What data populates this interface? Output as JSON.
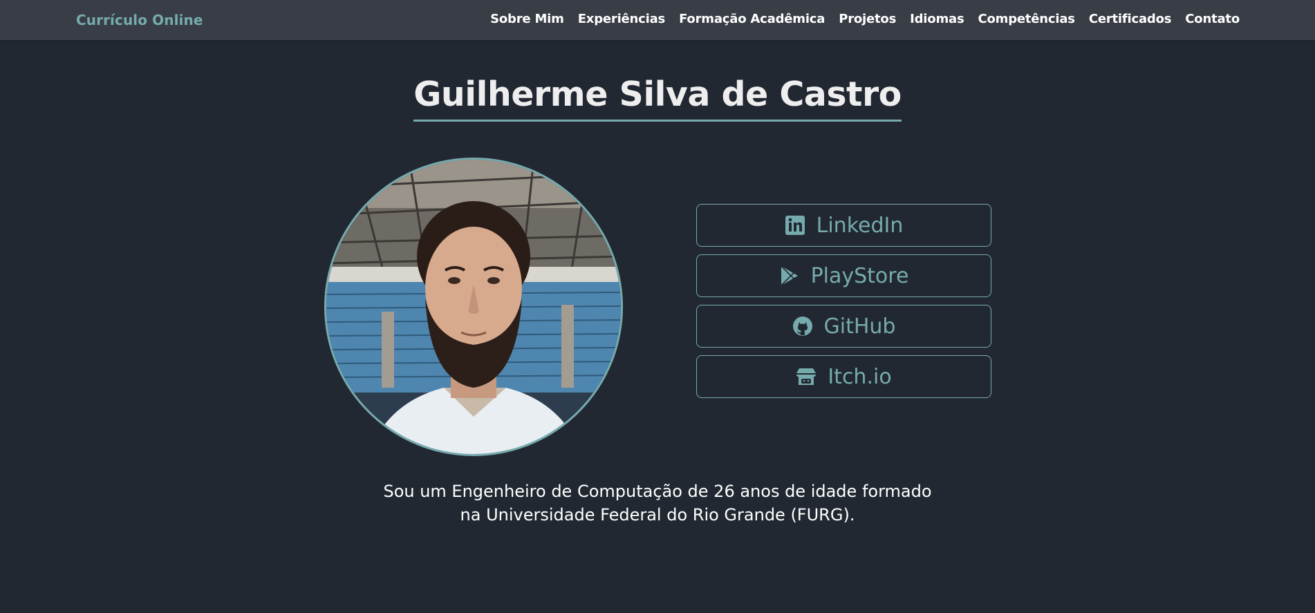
{
  "navbar": {
    "brand": "Currículo Online",
    "links": [
      {
        "label": "Sobre Mim"
      },
      {
        "label": "Experiências"
      },
      {
        "label": "Formação Acadêmica"
      },
      {
        "label": "Projetos"
      },
      {
        "label": "Idiomas"
      },
      {
        "label": "Competências"
      },
      {
        "label": "Certificados"
      },
      {
        "label": "Contato"
      }
    ]
  },
  "profile": {
    "name": "Guilherme Silva de Castro"
  },
  "social": [
    {
      "label": "LinkedIn",
      "icon": "linkedin-icon"
    },
    {
      "label": "PlayStore",
      "icon": "playstore-icon"
    },
    {
      "label": "GitHub",
      "icon": "github-icon"
    },
    {
      "label": "Itch.io",
      "icon": "itchio-icon"
    }
  ],
  "about": {
    "line1": "Sou um Engenheiro de Computação de 26 anos de idade formado",
    "line2": "na Universidade Federal do Rio Grande (FURG)."
  },
  "colors": {
    "background": "#222831",
    "navbar": "#393e46",
    "accent": "#76abae",
    "text": "#eeeeee"
  }
}
